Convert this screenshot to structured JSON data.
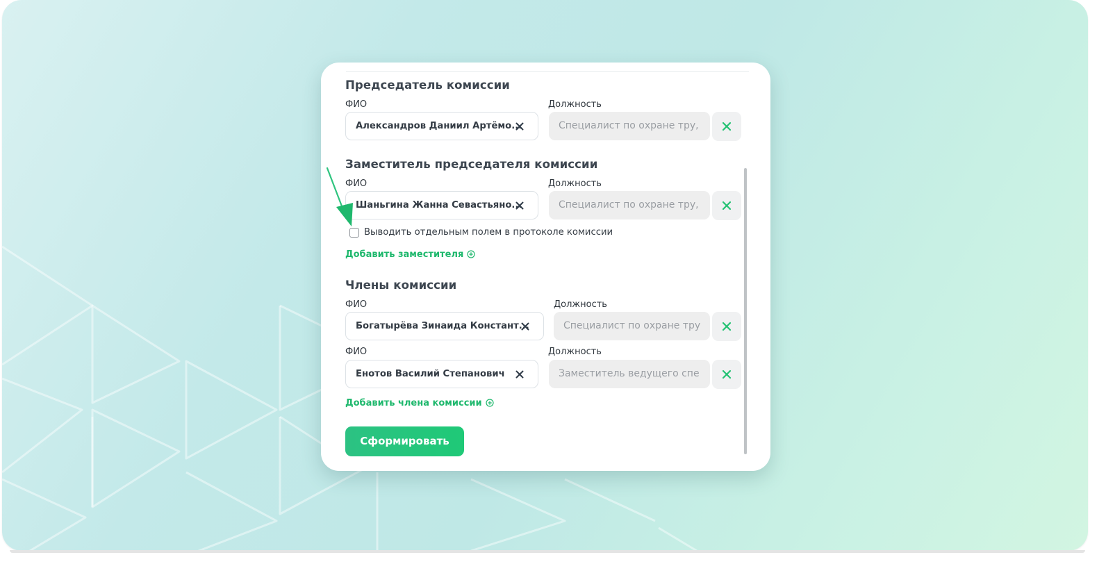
{
  "chairman": {
    "title": "Председатель комиссии",
    "fio_label": "ФИО",
    "position_label": "Должность",
    "name_value": "Александров Даниил Артёмо...",
    "position_value": "Специалист по охране тру,"
  },
  "deputy": {
    "title": "Заместитель председателя комиссии",
    "fio_label": "ФИО",
    "position_label": "Должность",
    "name_value": "Шаньгина Жанна Севастьяно...",
    "position_value": "Специалист по охране тру,",
    "checkbox_label": "Выводить отдельным полем в протоколе комиссии",
    "checkbox_checked": false,
    "add_link": "Добавить заместителя"
  },
  "members": {
    "title": "Члены комиссии",
    "rows": [
      {
        "fio_label": "ФИО",
        "position_label": "Должность",
        "name_value": "Богатырёва Зинаида Констант...",
        "position_value": "Специалист по охране тру"
      },
      {
        "fio_label": "ФИО",
        "position_label": "Должность",
        "name_value": "Енотов Василий Степанович",
        "position_value": "Заместитель ведущего спе"
      }
    ],
    "add_link": "Добавить члена комиссии"
  },
  "submit_label": "Сформировать",
  "colors": {
    "accent": "#1fb86d",
    "remove_icon": "#22c272",
    "clear_icon": "#2f3b48",
    "button": "#22c57b"
  },
  "icons": {
    "clear": "close-icon",
    "remove": "close-icon",
    "add": "plus-circle-icon",
    "annotation": "arrow-icon"
  }
}
